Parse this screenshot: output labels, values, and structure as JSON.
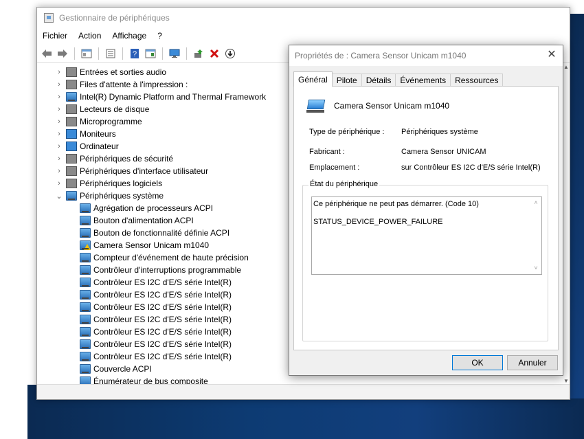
{
  "window": {
    "title": "Gestionnaire de périphériques"
  },
  "menu": [
    "Fichier",
    "Action",
    "Affichage",
    "?"
  ],
  "toolbar": {
    "icons": [
      "back-icon",
      "forward-icon",
      "properties-icon",
      "console-tree-icon",
      "help-icon",
      "device-list-icon",
      "monitor-icon",
      "update-driver-icon",
      "uninstall-icon",
      "disable-icon"
    ]
  },
  "tree": {
    "categories": [
      {
        "label": "Entrées et sorties audio",
        "expanded": false
      },
      {
        "label": "Files d'attente à l'impression :",
        "expanded": false
      },
      {
        "label": "Intel(R) Dynamic Platform and Thermal Framework",
        "expanded": false
      },
      {
        "label": "Lecteurs de disque",
        "expanded": false
      },
      {
        "label": "Microprogramme",
        "expanded": false
      },
      {
        "label": "Moniteurs",
        "expanded": false
      },
      {
        "label": "Ordinateur",
        "expanded": false
      },
      {
        "label": "Périphériques de sécurité",
        "expanded": false
      },
      {
        "label": "Périphériques d'interface utilisateur",
        "expanded": false
      },
      {
        "label": "Périphériques logiciels",
        "expanded": false
      },
      {
        "label": "Périphériques système",
        "expanded": true
      }
    ],
    "children": [
      {
        "label": "Agrégation de processeurs ACPI",
        "warning": false
      },
      {
        "label": "Bouton d'alimentation ACPI",
        "warning": false
      },
      {
        "label": "Bouton de fonctionnalité définie ACPI",
        "warning": false
      },
      {
        "label": "Camera Sensor Unicam m1040",
        "warning": true
      },
      {
        "label": "Compteur d'événement de haute précision",
        "warning": false
      },
      {
        "label": "Contrôleur d'interruptions programmable",
        "warning": false
      },
      {
        "label": "Contrôleur ES I2C d'E/S série Intel(R)",
        "warning": false
      },
      {
        "label": "Contrôleur ES I2C d'E/S série Intel(R)",
        "warning": false
      },
      {
        "label": "Contrôleur ES I2C d'E/S série Intel(R)",
        "warning": false
      },
      {
        "label": "Contrôleur ES I2C d'E/S série Intel(R)",
        "warning": false
      },
      {
        "label": "Contrôleur ES I2C d'E/S série Intel(R)",
        "warning": false
      },
      {
        "label": "Contrôleur ES I2C d'E/S série Intel(R)",
        "warning": false
      },
      {
        "label": "Contrôleur ES I2C d'E/S série Intel(R)",
        "warning": false
      },
      {
        "label": "Couvercle ACPI",
        "warning": false
      },
      {
        "label": "Énumérateur de bus composite",
        "warning": false
      }
    ]
  },
  "dialog": {
    "title": "Propriétés de : Camera Sensor Unicam m1040",
    "close_glyph": "✕",
    "tabs": [
      "Général",
      "Pilote",
      "Détails",
      "Événements",
      "Ressources"
    ],
    "active_tab": "Général",
    "device_name": "Camera Sensor Unicam m1040",
    "type_label": "Type de périphérique :",
    "type_value": "Périphériques système",
    "maker_label": "Fabricant :",
    "maker_value": "Camera Sensor UNICAM",
    "location_label": "Emplacement :",
    "location_value": "sur Contrôleur ES I2C d'E/S série Intel(R)",
    "status_group_label": "État du périphérique",
    "status_line1": "Ce périphérique ne peut pas démarrer. (Code 10)",
    "status_line2": "STATUS_DEVICE_POWER_FAILURE",
    "ok_label": "OK",
    "cancel_label": "Annuler"
  }
}
